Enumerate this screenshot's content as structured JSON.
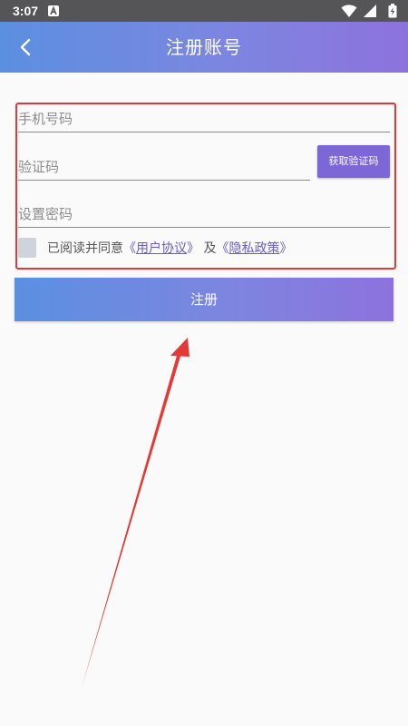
{
  "status_bar": {
    "time": "3:07",
    "notification_icon": "a-badge-icon",
    "icons": [
      "wifi-icon",
      "signal-icon",
      "battery-charging-icon"
    ]
  },
  "app_bar": {
    "title": "注册账号",
    "back_icon": "chevron-left-icon"
  },
  "form": {
    "phone_placeholder": "手机号码",
    "code_placeholder": "验证码",
    "get_code_label": "获取验证码",
    "password_placeholder": "设置密码",
    "agreement": {
      "prefix": "已阅读并同意",
      "open_bracket_1": "《",
      "user_agreement": "用户协议",
      "close_bracket_1": "》",
      "connector": "及",
      "open_bracket_2": "《",
      "privacy_policy": "隐私政策",
      "close_bracket_2": "》"
    },
    "register_label": "注册"
  },
  "colors": {
    "accent": "#7b68d6",
    "gradient_start": "#5b8fe0",
    "gradient_end": "#8d72dd",
    "annotation_red": "#e53935"
  }
}
